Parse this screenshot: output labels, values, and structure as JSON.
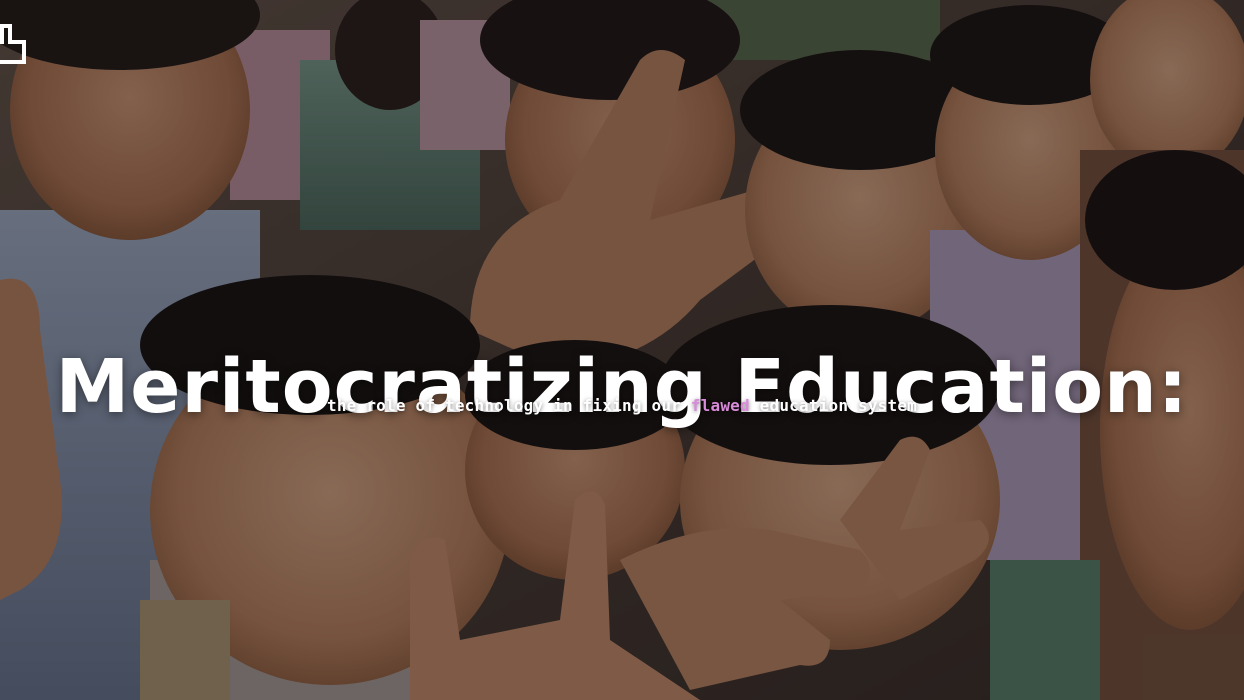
{
  "hero": {
    "title": "Meritocratizing Education:",
    "subtitle_before": "the role of technology in fixing our ",
    "subtitle_highlight": "flawed",
    "subtitle_after": " education system",
    "background_image": "group of smiling school children making peace signs",
    "logo_icon": "brand-logo-icon"
  },
  "colors": {
    "title_text": "#ffffff",
    "subtitle_text": "#ffffff",
    "highlight": "#d88bd8",
    "overlay": "rgba(12,10,12,0.42)"
  }
}
